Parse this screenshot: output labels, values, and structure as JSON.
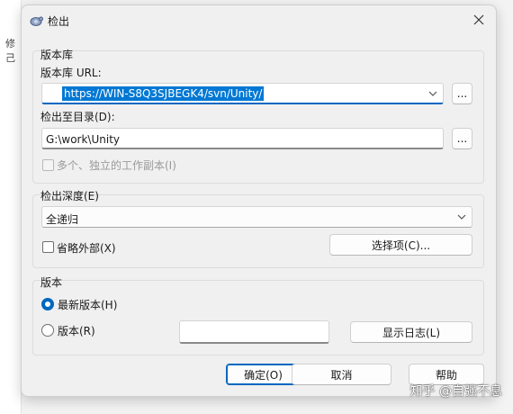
{
  "background": {
    "left_text": "修己"
  },
  "window": {
    "title": "检出",
    "close_glyph": "✕"
  },
  "repository": {
    "group_title": "版本库",
    "url_label": "版本库 URL:",
    "url_value": "https://WIN-S8Q3SJBEGK4/svn/Unity/",
    "url_browse_label": "...",
    "dir_label": "检出至目录(D):",
    "dir_value": "G:\\work\\Unity",
    "dir_browse_label": "...",
    "multiple_label": "多个、独立的工作副本(I)"
  },
  "depth": {
    "group_title": "检出深度(E)",
    "selected": "全递归",
    "omit_externals_label": "省略外部(X)",
    "choose_items_label": "选择项(C)..."
  },
  "revision": {
    "group_title": "版本",
    "head_label": "最新版本(H)",
    "revision_label": "版本(R)",
    "revision_value": "",
    "show_log_label": "显示日志(L)"
  },
  "footer": {
    "ok_label": "确定(O)",
    "cancel_label": "取消",
    "help_label": "帮助"
  },
  "watermark": "知乎 @自强不息",
  "colors": {
    "accent": "#0067c0",
    "selection": "#0078d4"
  }
}
